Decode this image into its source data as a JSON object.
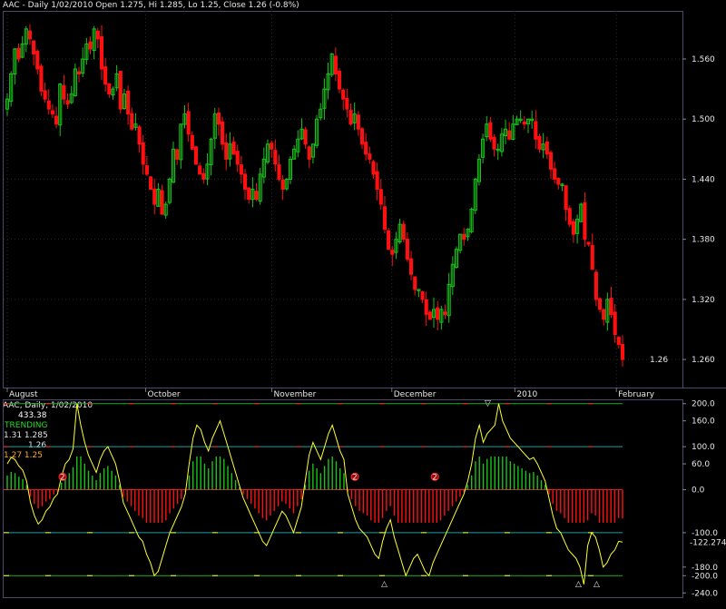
{
  "header": {
    "title": "AAC - Daily 1/02/2010 Open 1.275, Hi 1.285, Lo 1.25, Close 1.26 (-0.8%)"
  },
  "indicator_header": {
    "title": "AAC, Daily, 1/02/2010",
    "value": "433.38",
    "state": "TRENDING",
    "line3": "1.31  1.285",
    "line4": "1.26",
    "line5": "1.27  1.25"
  },
  "colors": {
    "up": "#19c419",
    "down": "#ff1010",
    "cci": "#ffff33",
    "grid": "#2b2b2b",
    "axis": "#4a4a70"
  },
  "chart_data": [
    {
      "type": "candlestick",
      "title": "AAC - Daily 1/02/2010 Open 1.275, Hi 1.285, Lo 1.25, Close 1.26 (-0.8%)",
      "ylim": [
        1.232,
        1.608
      ],
      "yticks": [
        "1.560",
        "1.500",
        "1.440",
        "1.380",
        "1.320",
        "1.260"
      ],
      "last_price_label": "1.26",
      "months": [
        "August",
        "October",
        "November",
        "December",
        "2010",
        "February"
      ],
      "closes": [
        1.52,
        1.545,
        1.57,
        1.56,
        1.575,
        1.59,
        1.58,
        1.565,
        1.55,
        1.528,
        1.52,
        1.51,
        1.505,
        1.495,
        1.535,
        1.52,
        1.515,
        1.525,
        1.55,
        1.545,
        1.56,
        1.575,
        1.57,
        1.59,
        1.58,
        1.55,
        1.535,
        1.525,
        1.53,
        1.545,
        1.51,
        1.525,
        1.505,
        1.49,
        1.495,
        1.475,
        1.455,
        1.445,
        1.43,
        1.415,
        1.43,
        1.405,
        1.415,
        1.44,
        1.47,
        1.46,
        1.495,
        1.505,
        1.485,
        1.47,
        1.455,
        1.445,
        1.44,
        1.455,
        1.48,
        1.505,
        1.495,
        1.475,
        1.46,
        1.475,
        1.465,
        1.455,
        1.445,
        1.43,
        1.42,
        1.43,
        1.42,
        1.445,
        1.46,
        1.475,
        1.47,
        1.455,
        1.44,
        1.43,
        1.44,
        1.46,
        1.47,
        1.48,
        1.49,
        1.475,
        1.46,
        1.475,
        1.5,
        1.51,
        1.53,
        1.545,
        1.565,
        1.545,
        1.53,
        1.52,
        1.51,
        1.495,
        1.505,
        1.49,
        1.475,
        1.465,
        1.46,
        1.445,
        1.43,
        1.415,
        1.39,
        1.37,
        1.365,
        1.38,
        1.395,
        1.38,
        1.36,
        1.345,
        1.33,
        1.33,
        1.32,
        1.305,
        1.3,
        1.31,
        1.3,
        1.31,
        1.305,
        1.335,
        1.355,
        1.37,
        1.385,
        1.38,
        1.39,
        1.41,
        1.44,
        1.46,
        1.48,
        1.495,
        1.48,
        1.47,
        1.47,
        1.485,
        1.49,
        1.48,
        1.495,
        1.5,
        1.5,
        1.495,
        1.5,
        1.5,
        1.48,
        1.47,
        1.475,
        1.465,
        1.45,
        1.44,
        1.435,
        1.435,
        1.41,
        1.395,
        1.385,
        1.4,
        1.415,
        1.38,
        1.375,
        1.35,
        1.32,
        1.31,
        1.3,
        1.32,
        1.305,
        1.285,
        1.275,
        1.26
      ]
    },
    {
      "type": "oscillator",
      "title": "AAC, Daily, 1/02/2010",
      "ylim": [
        -250,
        210
      ],
      "yticks": [
        "200.0",
        "160.0",
        "100.0",
        "60.0",
        "0.0",
        "-100.0",
        "-180.0",
        "-200.0",
        "-240.0"
      ],
      "last_value_label": "-122.274",
      "levels": [
        200,
        100,
        0,
        -100,
        -200
      ],
      "values": [
        60,
        75,
        70,
        55,
        45,
        20,
        -30,
        -60,
        -80,
        -70,
        -50,
        -40,
        -20,
        -10,
        30,
        60,
        70,
        95,
        200,
        150,
        110,
        80,
        60,
        40,
        70,
        90,
        100,
        80,
        60,
        20,
        -30,
        -50,
        -70,
        -90,
        -110,
        -120,
        -150,
        -170,
        -200,
        -190,
        -160,
        -130,
        -100,
        -80,
        -60,
        -40,
        -10,
        60,
        120,
        150,
        140,
        110,
        90,
        120,
        140,
        160,
        130,
        100,
        70,
        40,
        10,
        -20,
        -40,
        -60,
        -80,
        -100,
        -120,
        -130,
        -110,
        -90,
        -70,
        -50,
        -60,
        -80,
        -100,
        -70,
        -40,
        20,
        80,
        110,
        90,
        70,
        100,
        130,
        150,
        120,
        90,
        70,
        -10,
        -40,
        -70,
        -90,
        -100,
        -110,
        -130,
        -150,
        -160,
        -120,
        -90,
        -70,
        -110,
        -140,
        -170,
        -200,
        -180,
        -160,
        -150,
        -170,
        -190,
        -200,
        -170,
        -150,
        -130,
        -110,
        -90,
        -70,
        -50,
        -30,
        -10,
        20,
        60,
        120,
        150,
        110,
        130,
        140,
        150,
        200,
        160,
        140,
        120,
        110,
        100,
        90,
        80,
        70,
        75,
        60,
        40,
        20,
        -20,
        -60,
        -90,
        -100,
        -120,
        -140,
        -150,
        -160,
        -180,
        -220,
        -130,
        -100,
        -110,
        -140,
        -180,
        -170,
        -150,
        -140,
        -120,
        -122
      ]
    }
  ],
  "markers": {
    "circles": [
      "2",
      "2",
      "2"
    ],
    "down_triangle": "▽",
    "up_triangle": "△"
  }
}
